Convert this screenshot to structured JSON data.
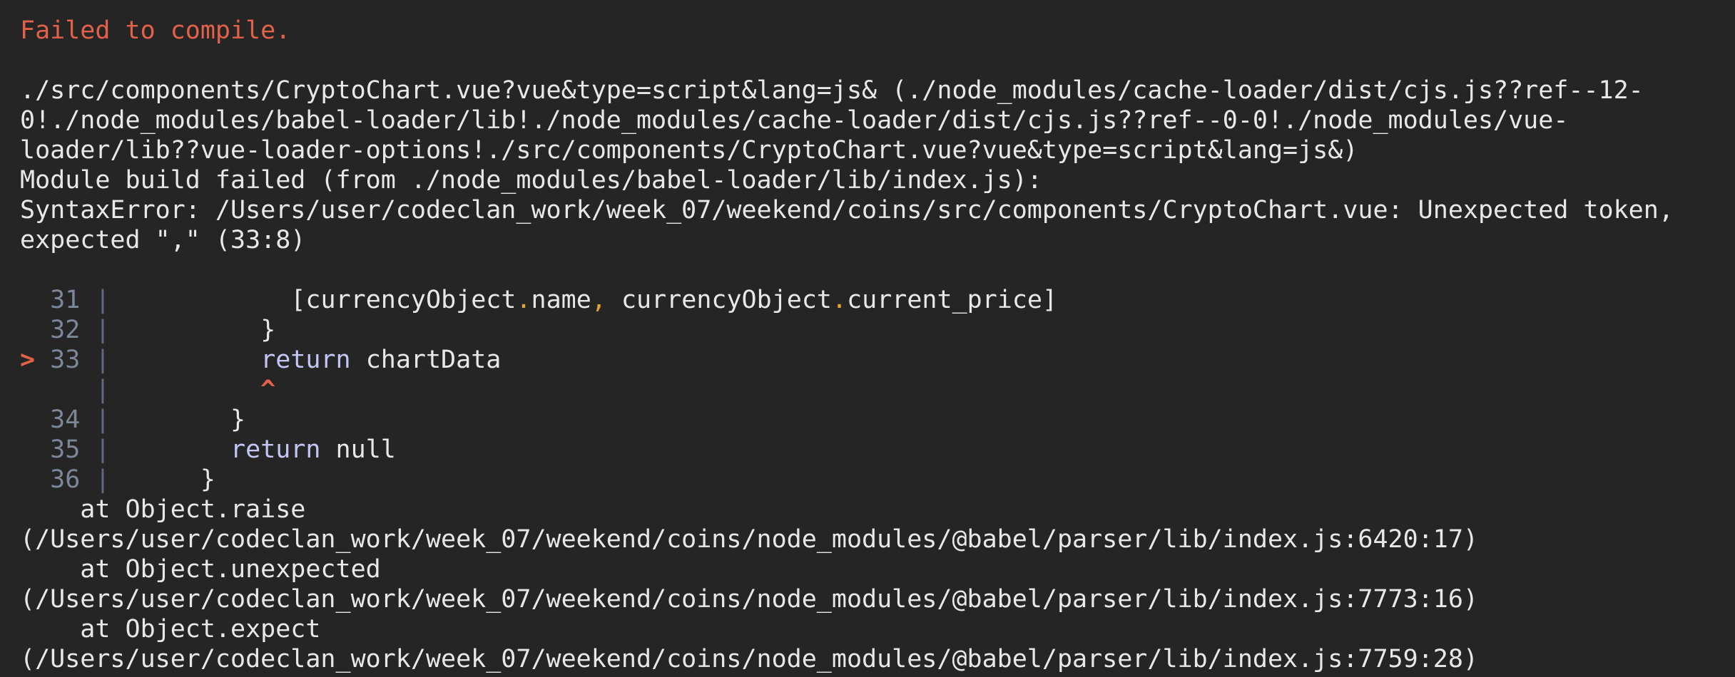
{
  "header": {
    "title": "Failed to compile."
  },
  "message": {
    "lines": [
      "./src/components/CryptoChart.vue?vue&type=script&lang=js& (./node_modules/cache-loader/dist/cjs.js??ref--12-",
      "0!./node_modules/babel-loader/lib!./node_modules/cache-loader/dist/cjs.js??ref--0-0!./node_modules/vue-",
      "loader/lib??vue-loader-options!./src/components/CryptoChart.vue?vue&type=script&lang=js&)",
      "Module build failed (from ./node_modules/babel-loader/lib/index.js):",
      "SyntaxError: /Users/user/codeclan_work/week_07/weekend/coins/src/components/CryptoChart.vue: Unexpected token,",
      "expected \",\" (33:8)"
    ]
  },
  "code_frame": {
    "marker": ">",
    "pipe": "|",
    "caret": "^",
    "lines": [
      {
        "num": "31",
        "indent": "            ",
        "text": "[currencyObject.name, currencyObject.current_price]"
      },
      {
        "num": "32",
        "indent": "          ",
        "text": "}"
      },
      {
        "num": "33",
        "indent": "          ",
        "kw": "return",
        "text": " chartData",
        "active": true
      },
      {
        "num": "34",
        "indent": "        ",
        "text": "}"
      },
      {
        "num": "35",
        "indent": "        ",
        "kw": "return",
        "text": " null"
      },
      {
        "num": "36",
        "indent": "      ",
        "text": "}"
      }
    ],
    "line31": {
      "a": "currencyObject",
      "b": "name",
      "c": "currencyObject",
      "d": "current_price"
    }
  },
  "stack": {
    "frames": [
      {
        "fn": "    at Object.raise",
        "loc": "(/Users/user/codeclan_work/week_07/weekend/coins/node_modules/@babel/parser/lib/index.js:6420:17)"
      },
      {
        "fn": "    at Object.unexpected",
        "loc": "(/Users/user/codeclan_work/week_07/weekend/coins/node_modules/@babel/parser/lib/index.js:7773:16)"
      },
      {
        "fn": "    at Object.expect",
        "loc": "(/Users/user/codeclan_work/week_07/weekend/coins/node_modules/@babel/parser/lib/index.js:7759:28)"
      }
    ]
  },
  "colors": {
    "background": "#252525",
    "error": "#e36049",
    "text": "#e8e8e8",
    "keyword": "#c3c6f5",
    "punctuation": "#e0a63c",
    "line_number": "#7c8799"
  }
}
